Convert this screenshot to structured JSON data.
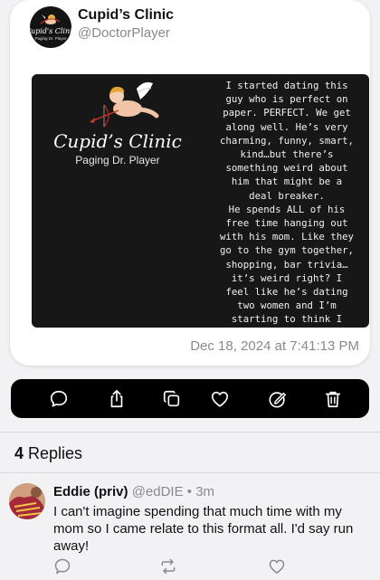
{
  "post": {
    "display_name": "Cupid’s Clinic",
    "handle": "@DoctorPlayer",
    "avatar_text": "Cupid's Clinic",
    "avatar_subtext": "Paging Dr. Player",
    "media": {
      "brand": "Cupid’s Clinic",
      "tagline": "Paging Dr. Player",
      "text": "I started dating this\nguy who is perfect on\npaper. PERFECT. We get\nalong well. He’s very\ncharming, funny, smart,\nkind…but there’s\nsomething weird about\nhim that might be a\ndeal breaker.\nHe spends ALL of his\nfree time hanging out\nwith his mom. Like they\ngo to the gym together,\nshopping, bar trivia…\nit’s weird right? I\nfeel like he’s dating\ntwo women and I’m\nstarting to think I"
    },
    "timestamp": "Dec 18, 2024 at 7:41:13 PM"
  },
  "actions": [
    {
      "icon": "comment-icon"
    },
    {
      "icon": "share-icon"
    },
    {
      "icon": "copy-icon"
    },
    {
      "icon": "heart-icon"
    },
    {
      "icon": "edit-icon"
    },
    {
      "icon": "trash-icon"
    }
  ],
  "replies": {
    "count": "4",
    "label": "Replies"
  },
  "reply": {
    "name": "Eddie (priv)",
    "handle": "@edDIE",
    "separator": "•",
    "time": "3m",
    "body": "I can't imagine spending that much time with my mom so I came relate to this format all. I'd say run away!"
  },
  "colors": {
    "background": "#f2f2f4",
    "action_bar": "#000000",
    "muted_text": "#8a8a8e"
  }
}
